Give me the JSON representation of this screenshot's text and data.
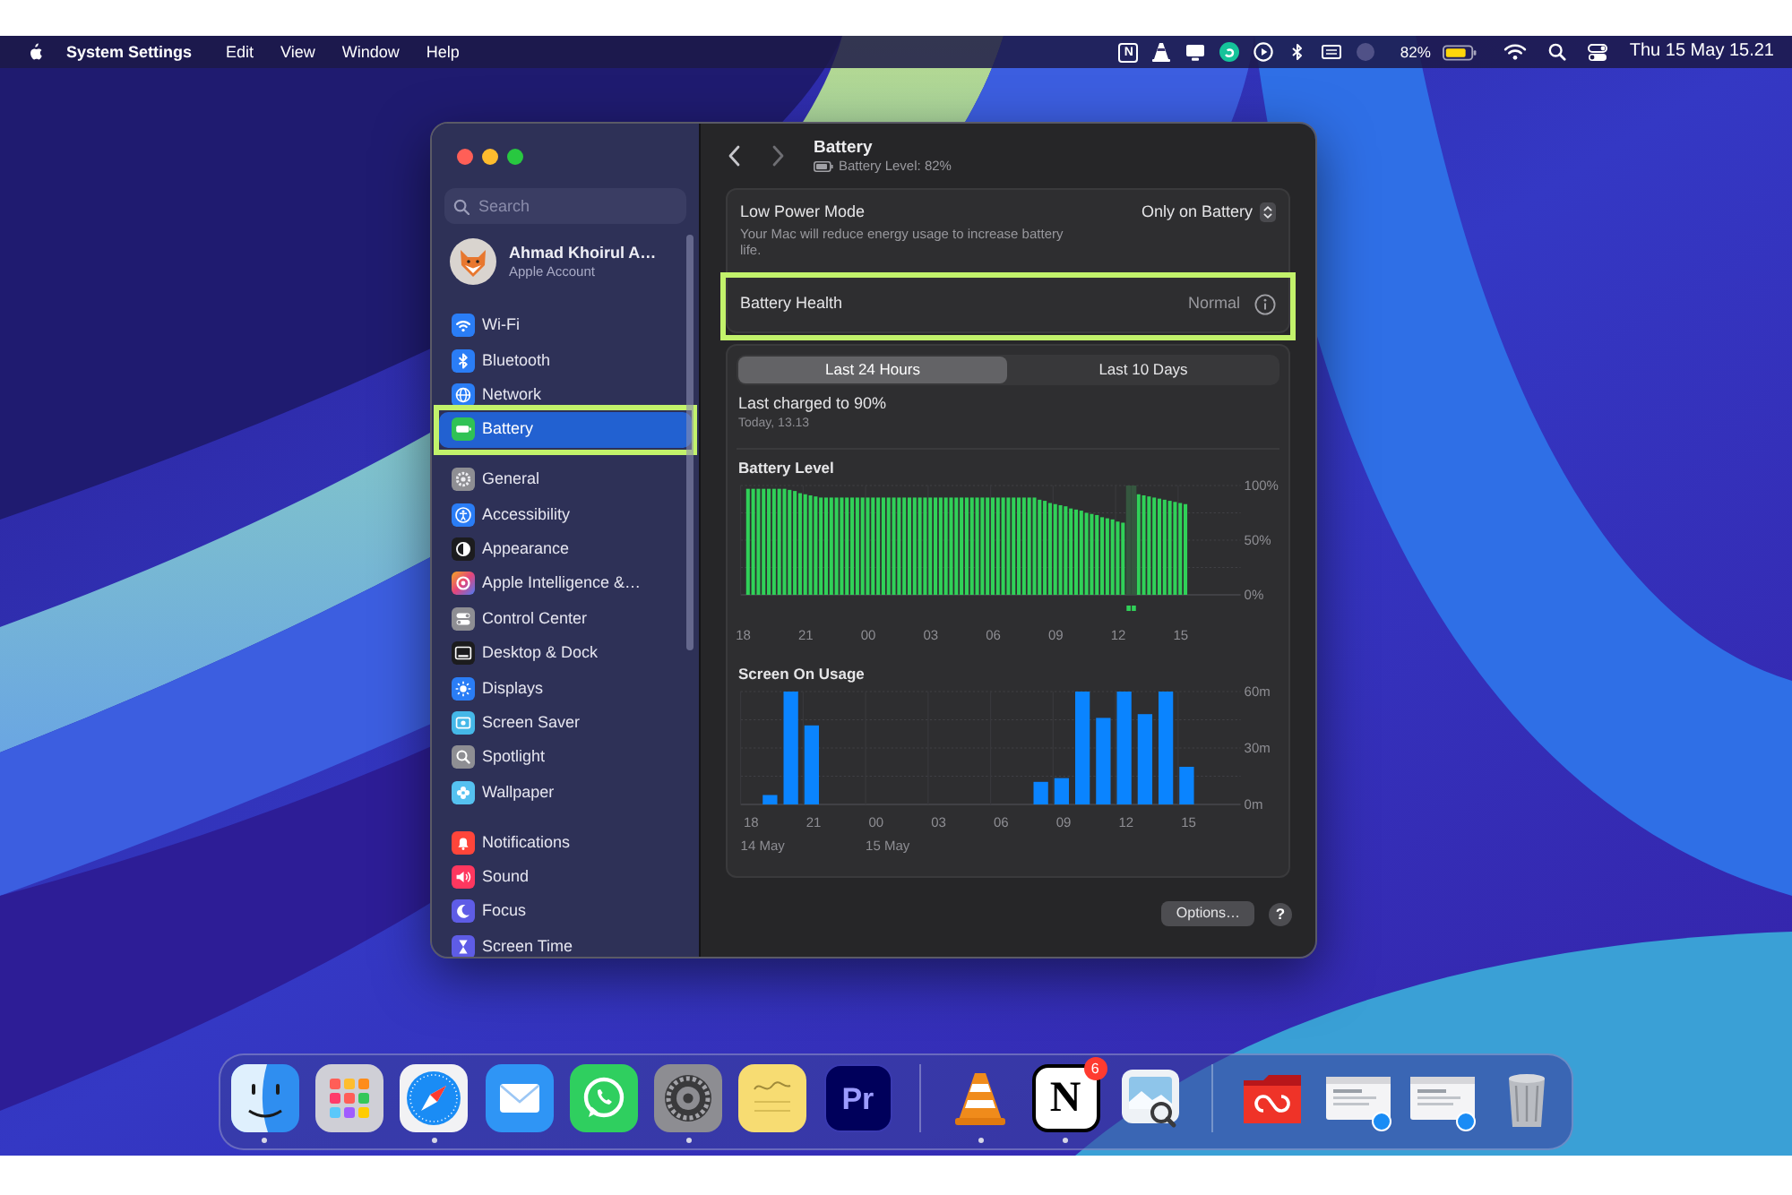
{
  "menu_bar": {
    "app_name": "System Settings",
    "menus": [
      "Edit",
      "View",
      "Window",
      "Help"
    ],
    "status_items": [
      {
        "kind": "notion",
        "label": "N"
      },
      {
        "kind": "vlc"
      },
      {
        "kind": "monitor"
      },
      {
        "kind": "app_circle"
      },
      {
        "kind": "play"
      },
      {
        "kind": "bluetooth"
      },
      {
        "kind": "keyboard"
      },
      {
        "kind": "dimmed"
      }
    ],
    "battery_text": "82%",
    "clock": "Thu 15 May 15.21"
  },
  "window": {
    "sidebar": {
      "search": {
        "placeholder": "Search"
      },
      "account": {
        "name": "Ahmad Khoirul A…",
        "subtitle": "Apple Account"
      },
      "groups": [
        {
          "items": [
            {
              "kind": "wifi",
              "label": "Wi-Fi",
              "selected": false,
              "highlighted": false
            },
            {
              "kind": "bluetooth",
              "label": "Bluetooth",
              "selected": false,
              "highlighted": false
            },
            {
              "kind": "network",
              "label": "Network",
              "selected": false,
              "highlighted": false
            },
            {
              "kind": "battery",
              "label": "Battery",
              "selected": true,
              "highlighted": true
            }
          ]
        },
        {
          "items": [
            {
              "kind": "general",
              "label": "General",
              "selected": false,
              "highlighted": false
            },
            {
              "kind": "accessibility",
              "label": "Accessibility",
              "selected": false,
              "highlighted": false
            },
            {
              "kind": "appearance",
              "label": "Appearance",
              "selected": false,
              "highlighted": false
            },
            {
              "kind": "apple_intelligence",
              "label": "Apple Intelligence &…",
              "selected": false,
              "highlighted": false
            },
            {
              "kind": "control_center",
              "label": "Control Center",
              "selected": false,
              "highlighted": false
            },
            {
              "kind": "desktop_dock",
              "label": "Desktop & Dock",
              "selected": false,
              "highlighted": false
            },
            {
              "kind": "displays",
              "label": "Displays",
              "selected": false,
              "highlighted": false
            },
            {
              "kind": "screen_saver",
              "label": "Screen Saver",
              "selected": false,
              "highlighted": false
            },
            {
              "kind": "spotlight",
              "label": "Spotlight",
              "selected": false,
              "highlighted": false
            },
            {
              "kind": "wallpaper",
              "label": "Wallpaper",
              "selected": false,
              "highlighted": false
            }
          ]
        },
        {
          "items": [
            {
              "kind": "notifications",
              "label": "Notifications",
              "selected": false,
              "highlighted": false
            },
            {
              "kind": "sound",
              "label": "Sound",
              "selected": false,
              "highlighted": false
            },
            {
              "kind": "focus",
              "label": "Focus",
              "selected": false,
              "highlighted": false
            },
            {
              "kind": "screen_time",
              "label": "Screen Time",
              "selected": false,
              "highlighted": false
            }
          ]
        }
      ]
    },
    "header": {
      "title": "Battery",
      "subtitle": "Battery Level: 82%"
    },
    "settings": [
      {
        "kind": "popup",
        "label": "Low Power Mode",
        "description": "Your Mac will reduce energy usage to increase battery life.",
        "value": "Only on Battery",
        "highlighted": false
      },
      {
        "kind": "info",
        "label": "Battery Health",
        "value": "Normal",
        "highlighted": true
      }
    ],
    "range_tabs": [
      {
        "label": "Last 24 Hours",
        "selected": true
      },
      {
        "label": "Last 10 Days",
        "selected": false
      }
    ],
    "last_charged": {
      "title": "Last charged to 90%",
      "time": "Today, 13.13"
    },
    "charts": [
      {
        "chart_data": {
          "type": "bar",
          "title": "Battery Level",
          "categories": [
            "18",
            null,
            null,
            null,
            null,
            null,
            null,
            null,
            null,
            null,
            null,
            null,
            "21",
            null,
            null,
            null,
            null,
            null,
            null,
            null,
            null,
            null,
            null,
            null,
            "00",
            null,
            null,
            null,
            null,
            null,
            null,
            null,
            null,
            null,
            null,
            null,
            "03",
            null,
            null,
            null,
            null,
            null,
            null,
            null,
            null,
            null,
            null,
            null,
            "06",
            null,
            null,
            null,
            null,
            null,
            null,
            null,
            null,
            null,
            null,
            null,
            "09",
            null,
            null,
            null,
            null,
            null,
            null,
            null,
            null,
            null,
            null,
            null,
            "12",
            null,
            null,
            null,
            null,
            null,
            null,
            null,
            null,
            null,
            null,
            null,
            "15",
            null
          ],
          "series": [
            {
              "color": "#30d158",
              "values": [
                null,
                97,
                97,
                97,
                97,
                97,
                97,
                97,
                97,
                96,
                95,
                93,
                92,
                91,
                90,
                89,
                89,
                89,
                89,
                89,
                89,
                89,
                89,
                89,
                89,
                89,
                89,
                89,
                89,
                89,
                89,
                89,
                89,
                89,
                89,
                89,
                89,
                89,
                89,
                89,
                89,
                89,
                89,
                89,
                89,
                89,
                89,
                89,
                89,
                89,
                89,
                89,
                89,
                89,
                89,
                89,
                89,
                87,
                86,
                84,
                83,
                82,
                81,
                79,
                78,
                77,
                75,
                74,
                73,
                71,
                70,
                69,
                67,
                66,
                null,
                null,
                92,
                91,
                90,
                89,
                88,
                87,
                86,
                85,
                84,
                83
              ]
            },
            {
              "color": "#35573f",
              "values": [
                null,
                null,
                null,
                null,
                null,
                null,
                null,
                null,
                null,
                null,
                null,
                null,
                null,
                null,
                null,
                null,
                null,
                null,
                null,
                null,
                null,
                null,
                null,
                null,
                null,
                null,
                null,
                null,
                null,
                null,
                null,
                null,
                null,
                null,
                null,
                null,
                null,
                null,
                null,
                null,
                null,
                null,
                null,
                null,
                null,
                null,
                null,
                null,
                null,
                null,
                null,
                null,
                null,
                null,
                null,
                null,
                null,
                null,
                null,
                null,
                null,
                null,
                null,
                null,
                null,
                null,
                null,
                null,
                null,
                null,
                null,
                null,
                null,
                null,
                100,
                100,
                null,
                null,
                null,
                null,
                null,
                null,
                null,
                null,
                null,
                null
              ]
            }
          ],
          "ylim": [
            0,
            100
          ],
          "yticks": [
            {
              "value": 0,
              "label": "0%"
            },
            {
              "value": 50,
              "label": "50%"
            },
            {
              "value": 100,
              "label": "100%"
            }
          ]
        }
      },
      {
        "chart_data": {
          "type": "bar",
          "title": "Screen On Usage",
          "categories": [
            "18",
            null,
            null,
            "21",
            null,
            null,
            "00",
            null,
            null,
            "03",
            null,
            null,
            "06",
            null,
            null,
            "09",
            null,
            null,
            "12",
            null,
            null,
            "15"
          ],
          "series": [
            {
              "color": "#0a84ff",
              "values": [
                0,
                5,
                60,
                42,
                0,
                0,
                0,
                0,
                0,
                0,
                0,
                0,
                0,
                0,
                12,
                14,
                60,
                46,
                60,
                48,
                60,
                20
              ]
            }
          ],
          "ylim": [
            0,
            60
          ],
          "yticks": [
            {
              "value": 0,
              "label": "0m"
            },
            {
              "value": 30,
              "label": "30m"
            },
            {
              "value": 60,
              "label": "60m"
            }
          ]
        },
        "date_labels": [
          "14 May",
          "15 May"
        ]
      }
    ],
    "footer": {
      "options_button": "Options…",
      "help_button": "?"
    }
  },
  "dock": {
    "sections": [
      {
        "items": [
          {
            "kind": "finder",
            "running": true
          },
          {
            "kind": "launchpad",
            "running": false
          },
          {
            "kind": "safari",
            "running": true
          },
          {
            "kind": "mail",
            "running": false
          },
          {
            "kind": "whatsapp",
            "running": false
          },
          {
            "kind": "settings",
            "running": true
          },
          {
            "kind": "stickies",
            "running": false
          },
          {
            "kind": "premiere",
            "label": "Pr",
            "running": false
          }
        ]
      },
      {
        "items": [
          {
            "kind": "vlc",
            "running": true
          },
          {
            "kind": "notion",
            "label": "N",
            "badge": "6",
            "running": true
          },
          {
            "kind": "preview",
            "running": false
          }
        ]
      },
      {
        "items": [
          {
            "kind": "creative_cloud",
            "running": false
          },
          {
            "kind": "minimized_window",
            "running": false
          },
          {
            "kind": "minimized_window",
            "running": false
          },
          {
            "kind": "trash",
            "running": false
          }
        ]
      }
    ]
  }
}
